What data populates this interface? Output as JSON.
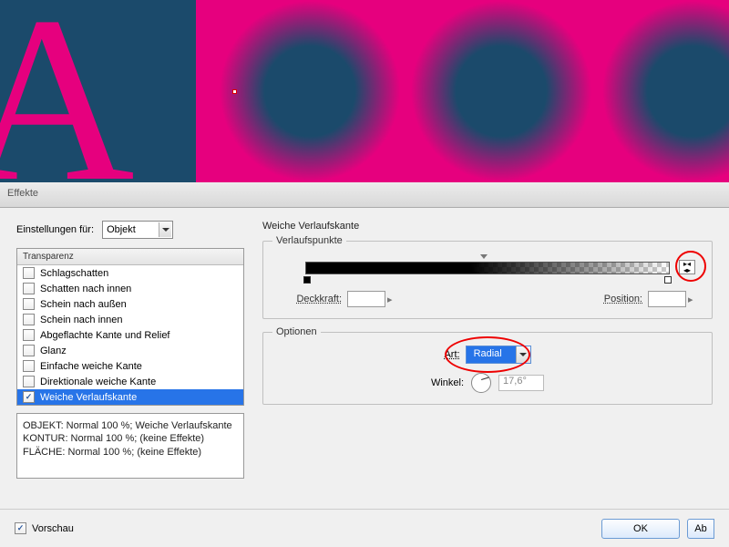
{
  "canvas": {
    "letter": "A"
  },
  "tab": {
    "label": "Effekte"
  },
  "settings": {
    "label": "Einstellungen für:",
    "object_dropdown": "Objekt"
  },
  "effects": {
    "header": "Transparenz",
    "items": [
      {
        "label": "Schlagschatten",
        "checked": false
      },
      {
        "label": "Schatten nach innen",
        "checked": false
      },
      {
        "label": "Schein nach außen",
        "checked": false
      },
      {
        "label": "Schein nach innen",
        "checked": false
      },
      {
        "label": "Abgeflachte Kante und Relief",
        "checked": false
      },
      {
        "label": "Glanz",
        "checked": false
      },
      {
        "label": "Einfache weiche Kante",
        "checked": false
      },
      {
        "label": "Direktionale weiche Kante",
        "checked": false
      },
      {
        "label": "Weiche Verlaufskante",
        "checked": true
      }
    ]
  },
  "info": {
    "line1": "OBJEKT: Normal 100 %; Weiche Verlaufskante",
    "line2": "KONTUR: Normal 100 %; (keine Effekte)",
    "line3": "FLÄCHE: Normal 100 %; (keine Effekte)"
  },
  "panel": {
    "title": "Weiche Verlaufskante",
    "gradient": {
      "legend": "Verlaufspunkte",
      "opacity_label": "Deckkraft:",
      "position_label": "Position:",
      "opacity_value": "",
      "position_value": ""
    },
    "options": {
      "legend": "Optionen",
      "art_label": "Art:",
      "art_value": "Radial",
      "angle_label": "Winkel:",
      "angle_value": "17,6°"
    }
  },
  "footer": {
    "preview": "Vorschau",
    "ok": "OK",
    "cancel": "Ab"
  }
}
